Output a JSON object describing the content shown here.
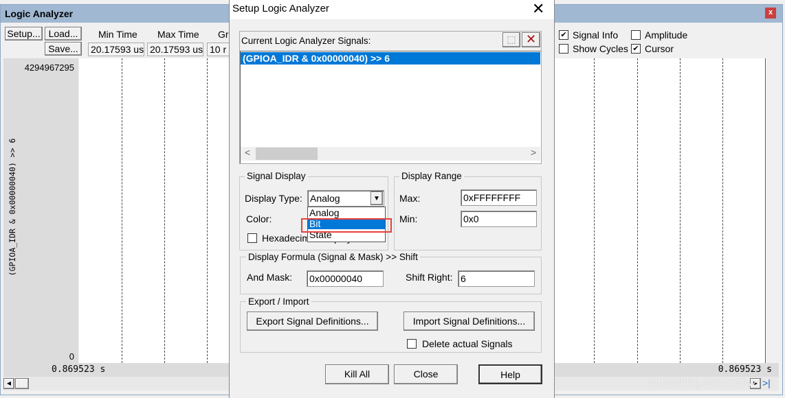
{
  "logic_analyzer": {
    "title": "Logic Analyzer",
    "close_label": "x",
    "setup_label": "Setup...",
    "load_label": "Load...",
    "save_label": "Save...",
    "min_time_label": "Min Time",
    "min_time_value": "20.17593 us",
    "max_time_label": "Max Time",
    "max_time_value": "20.17593 us",
    "grid_label": "Gri",
    "grid_value": "10 r",
    "signal_info_label": "Signal Info",
    "signal_info_checked": true,
    "amplitude_label": "Amplitude",
    "amplitude_checked": false,
    "show_cycles_label": "Show Cycles",
    "show_cycles_checked": false,
    "cursor_label": "Cursor",
    "cursor_checked": true,
    "y_max": "4294967295",
    "y_min": "0",
    "signal_name": "(GPIOA_IDR & 0x00000040) >> 6",
    "time_left": "0.869523 s",
    "time_right": "0.869523 s",
    "watermark": "https://blog.csdn.net/wz"
  },
  "dialog": {
    "title": "Setup Logic Analyzer",
    "signals_label": "Current Logic Analyzer Signals:",
    "signals": [
      "(GPIOA_IDR & 0x00000040) >> 6"
    ],
    "signal_display": {
      "legend": "Signal Display",
      "display_type_label": "Display Type:",
      "display_type_value": "Analog",
      "options": [
        "Analog",
        "Bit",
        "State"
      ],
      "highlighted_option": "Bit",
      "color_label": "Color:",
      "hex_label": "Hexadecimal Display",
      "hex_checked": false
    },
    "display_range": {
      "legend": "Display Range",
      "max_label": "Max:",
      "max_value": "0xFFFFFFFF",
      "min_label": "Min:",
      "min_value": "0x0"
    },
    "formula": {
      "legend": "Display Formula (Signal & Mask) >> Shift",
      "mask_label": "And Mask:",
      "mask_value": "0x00000040",
      "shift_label": "Shift Right:",
      "shift_value": "6"
    },
    "export_import": {
      "legend": "Export / Import",
      "export_label": "Export Signal Definitions...",
      "import_label": "Import Signal Definitions...",
      "delete_label": "Delete actual Signals",
      "delete_checked": false
    },
    "kill_all_label": "Kill All",
    "close_label": "Close",
    "help_label": "Help"
  },
  "colors": {
    "highlight": "#0078d7",
    "title_bar": "#a0b8d2",
    "annotation": "#e8403a"
  }
}
